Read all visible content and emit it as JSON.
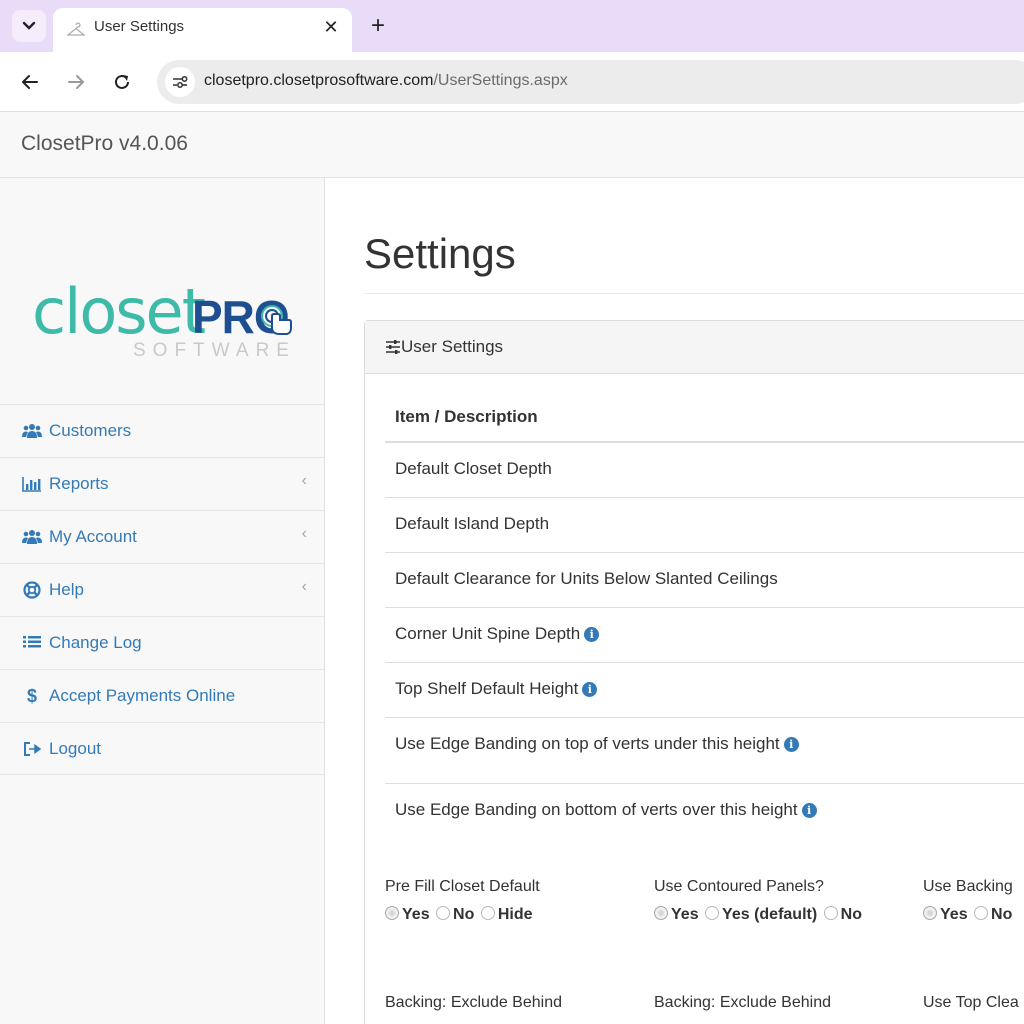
{
  "browser": {
    "tab_title": "User Settings",
    "url_host": "closetpro.closetprosoftware.com",
    "url_path": "/UserSettings.aspx"
  },
  "app": {
    "brand": "ClosetPro v4.0.06",
    "logo": {
      "closet": "closet",
      "pro": "PRO",
      "software": "SOFTWARE"
    }
  },
  "sidebar": {
    "items": [
      {
        "label": "Customers",
        "icon": "users-icon",
        "chevron": false
      },
      {
        "label": "Reports",
        "icon": "bar-chart-icon",
        "chevron": true
      },
      {
        "label": "My Account",
        "icon": "users-icon",
        "chevron": true
      },
      {
        "label": "Help",
        "icon": "lifebuoy-icon",
        "chevron": true
      },
      {
        "label": "Change Log",
        "icon": "list-icon",
        "chevron": false
      },
      {
        "label": "Accept Payments Online",
        "icon": "dollar-icon",
        "chevron": false
      },
      {
        "label": "Logout",
        "icon": "logout-icon",
        "chevron": false
      }
    ]
  },
  "main": {
    "title": "Settings",
    "panel_title": "User Settings",
    "table": {
      "header": "Item / Description",
      "rows": [
        {
          "label": "Default Closet Depth",
          "info": false
        },
        {
          "label": "Default Island Depth",
          "info": false
        },
        {
          "label": "Default Clearance for Units Below Slanted Ceilings",
          "info": false
        },
        {
          "label": "Corner Unit Spine Depth",
          "info": true
        },
        {
          "label": "Top Shelf Default Height",
          "info": true
        },
        {
          "label": "Use Edge Banding on top of verts under this height",
          "info": true
        },
        {
          "label": "Use Edge Banding on bottom of verts over this height",
          "info": true
        }
      ]
    },
    "options": [
      {
        "label": "Pre Fill Closet Default",
        "choices": [
          "Yes",
          "No",
          "Hide"
        ],
        "selected": "Yes"
      },
      {
        "label": "Use Contoured Panels?",
        "choices": [
          "Yes",
          "Yes (default)",
          "No"
        ],
        "selected": "Yes"
      },
      {
        "label": "Use Backing",
        "choices": [
          "Yes",
          "No"
        ],
        "selected": "Yes"
      }
    ],
    "options_row2": [
      {
        "label": "Backing: Exclude Behind"
      },
      {
        "label": "Backing: Exclude Behind"
      },
      {
        "label": "Use Top Clea"
      }
    ]
  },
  "colors": {
    "link": "#337ab7",
    "logo_teal": "#3dbaa8",
    "logo_navy": "#1d4f91",
    "tabbar": "#e9dcf8"
  }
}
